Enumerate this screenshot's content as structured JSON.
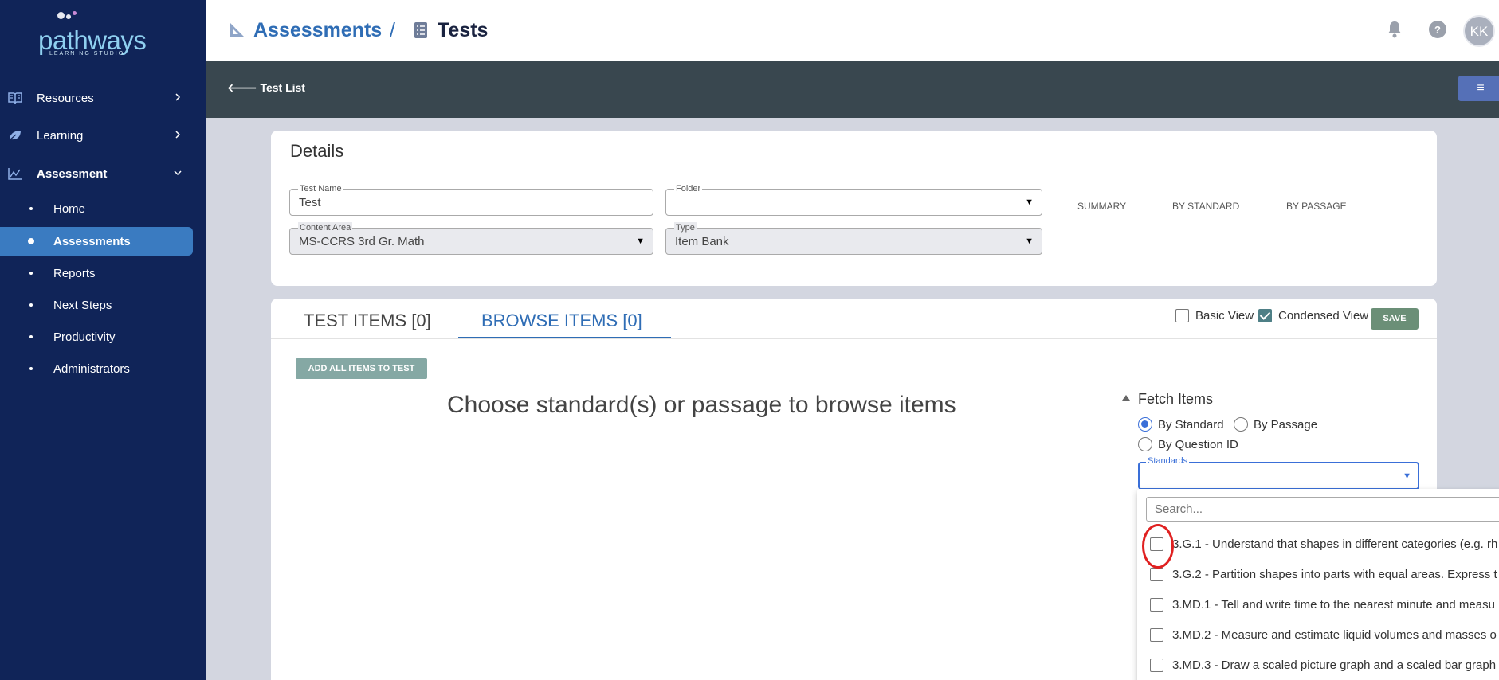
{
  "app": {
    "logo_text": "pathways",
    "logo_sub": "LEARNING STUDIO"
  },
  "sidebar": {
    "sections": [
      {
        "label": "Resources",
        "icon": "book-icon"
      },
      {
        "label": "Learning",
        "icon": "leaf-icon"
      },
      {
        "label": "Assessment",
        "icon": "chart-icon"
      }
    ],
    "assessment_items": [
      {
        "label": "Home"
      },
      {
        "label": "Assessments"
      },
      {
        "label": "Reports"
      },
      {
        "label": "Next Steps"
      },
      {
        "label": "Productivity"
      },
      {
        "label": "Administrators"
      }
    ]
  },
  "header": {
    "crumb_root": "Assessments",
    "crumb_sep": "/",
    "crumb_current": "Tests",
    "avatar_initials": "KK"
  },
  "subheader": {
    "back_label": "Test List",
    "menu_glyph": "≡"
  },
  "details": {
    "title": "Details",
    "test_name_label": "Test Name",
    "test_name_value": "Test",
    "folder_label": "Folder",
    "folder_value": "",
    "content_area_label": "Content Area",
    "content_area_value": "MS-CCRS 3rd Gr. Math",
    "type_label": "Type",
    "type_value": "Item Bank",
    "tabs": [
      "SUMMARY",
      "BY STANDARD",
      "BY PASSAGE"
    ]
  },
  "items": {
    "tab_test_items": "TEST ITEMS [0]",
    "tab_browse_items": "BROWSE ITEMS [0]",
    "basic_view_label": "Basic View",
    "condensed_view_label": "Condensed View",
    "basic_view_checked": false,
    "condensed_view_checked": true,
    "save_label": "SAVE",
    "add_all_label": "ADD ALL ITEMS TO TEST",
    "empty_message": "Choose standard(s) or passage to browse items",
    "fetch_title": "Fetch Items",
    "fetch_options": [
      "By Standard",
      "By Passage",
      "By Question ID"
    ],
    "fetch_selected": "By Standard",
    "standards_label": "Standards",
    "search_placeholder": "Search...",
    "standards": [
      "3.G.1 - Understand that shapes in different categories (e.g. rh",
      "3.G.2 - Partition shapes into parts with equal areas. Express t",
      "3.MD.1 - Tell and write time to the nearest minute and measu",
      "3.MD.2 - Measure and estimate liquid volumes and masses o",
      "3.MD.3 - Draw a scaled picture graph and a scaled bar graph"
    ]
  },
  "colors": {
    "sidebar_bg": "#102458",
    "active_item": "#3a7bc1",
    "brand_blue": "#2f6db5",
    "subheader_bg": "#39474f",
    "highlight_circle": "#e02020"
  }
}
